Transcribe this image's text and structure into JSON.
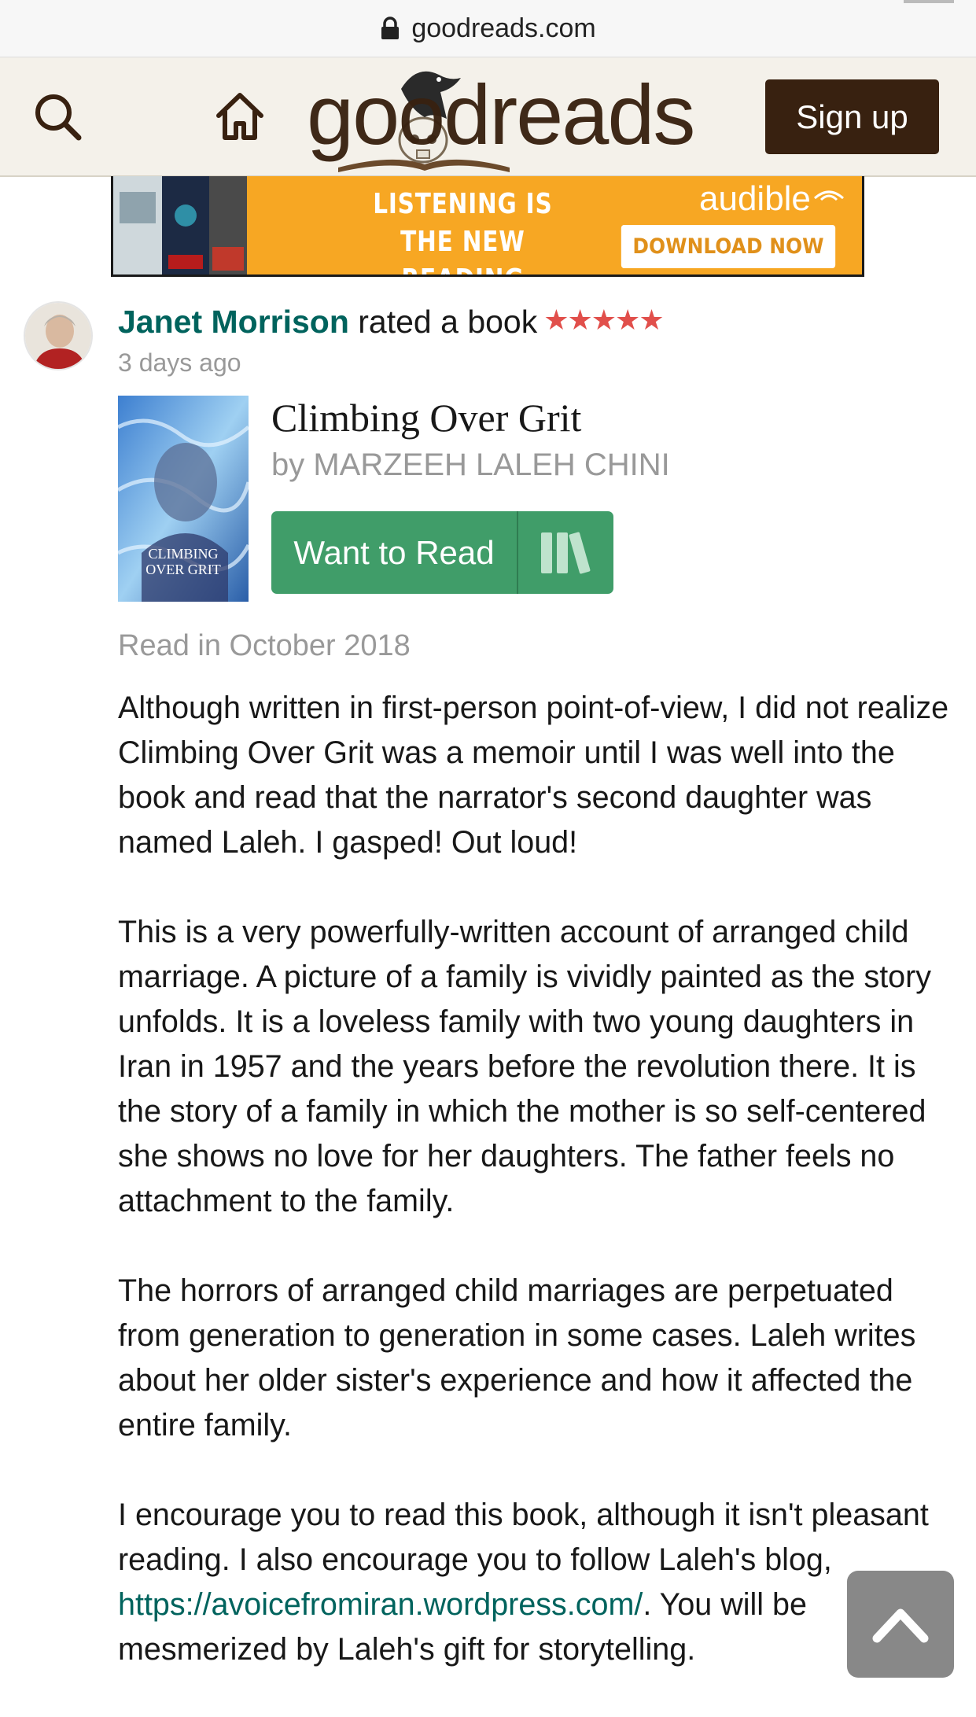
{
  "browser": {
    "url": "goodreads.com"
  },
  "header": {
    "logo_text": "goodreads",
    "signup_label": "Sign up"
  },
  "ad": {
    "tagline_line1": "LISTENING IS",
    "tagline_line2": "THE NEW READING",
    "brand": "audible",
    "cta": "DOWNLOAD NOW"
  },
  "review": {
    "reviewer": "Janet Morrison",
    "action": " rated a book",
    "stars": 5,
    "stars_glyphs": "★★★★★",
    "time_ago": "3 days ago",
    "book": {
      "title": "Climbing Over Grit",
      "author": "by MARZEEH LALEH CHINI",
      "cover_text": "CLIMBING OVER GRIT"
    },
    "want_to_read_label": "Want to Read",
    "read_date": "Read in October 2018",
    "paragraphs": [
      "Although written in first-person point-of-view, I did not realize Climbing Over Grit was a memoir until I was well into the book and read that the narrator's second daughter was named Laleh. I gasped! Out loud!",
      "This is a very powerfully-written account of arranged child marriage. A picture of a family is vividly painted as the story unfolds. It is a loveless family with two young daughters in Iran in 1957 and the years before the revolution there. It is the story of a family in which the mother is so self-centered she shows no love for her daughters. The father feels no attachment to the family.",
      "The horrors of arranged child marriages are perpetuated from generation to generation in some cases. Laleh writes about her older sister's experience and how it affected the entire family."
    ],
    "last_paragraph": {
      "before_link": "I encourage you to read this book, although it isn't pleasant reading. I also encourage you to follow Laleh's blog, ",
      "link": "https://avoicefromiran.wordpress.com/",
      "after_link": ". You will be mesmerized by Laleh's gift for storytelling."
    }
  },
  "colors": {
    "brand_brown": "#382110",
    "header_bg": "#f4f1ea",
    "link_green": "#00635d",
    "button_green": "#409d69",
    "star_red": "#e14f4b",
    "ad_orange": "#f7a723"
  },
  "icons": [
    "lock-icon",
    "search-icon",
    "home-icon",
    "bookshelf-icon",
    "chevron-up-icon"
  ]
}
